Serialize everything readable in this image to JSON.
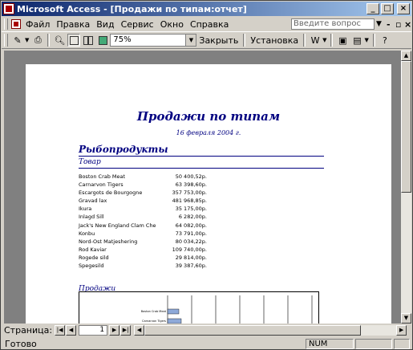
{
  "window": {
    "title": "Microsoft Access - [Продажи по типам:отчет]"
  },
  "menubar": {
    "items": [
      "Файл",
      "Правка",
      "Вид",
      "Сервис",
      "Окно",
      "Справка"
    ],
    "question_placeholder": "Введите вопрос"
  },
  "toolbar": {
    "zoom": "75%",
    "close_label": "Закрыть",
    "setup_label": "Установка"
  },
  "report": {
    "title": "Продажи по типам",
    "date": "16 февраля 2004 г.",
    "category": "Рыбопродукты",
    "col_header": "Товар",
    "rows": [
      {
        "name": "Boston Crab Meat",
        "value": "50 400,52р."
      },
      {
        "name": "Carnarvon Tigers",
        "value": "63 398,60р."
      },
      {
        "name": "Escargots de Bourgogne",
        "value": "357 753,00р."
      },
      {
        "name": "Gravad lax",
        "value": "481 968,85р."
      },
      {
        "name": "Ikura",
        "value": "35 175,00р."
      },
      {
        "name": "Inlagd Sill",
        "value": "6 282,00р."
      },
      {
        "name": "Jack's New England Clam Che",
        "value": "64 082,00р."
      },
      {
        "name": "Konbu",
        "value": "73 791,00р."
      },
      {
        "name": "Nord-Ost Matjeshering",
        "value": "80 034,22р."
      },
      {
        "name": "Rod Kaviar",
        "value": "109 740,00р."
      },
      {
        "name": "Rogede sild",
        "value": "29 814,00р."
      },
      {
        "name": "Spegesild",
        "value": "39 387,60р."
      }
    ],
    "sales_header": "Продажи",
    "chart_labels": [
      "Boston Crab Meat",
      "Carnarvon Tigers"
    ]
  },
  "nav": {
    "label": "Страница:",
    "page": "1"
  },
  "status": {
    "text": "Готово",
    "num": "NUM"
  }
}
